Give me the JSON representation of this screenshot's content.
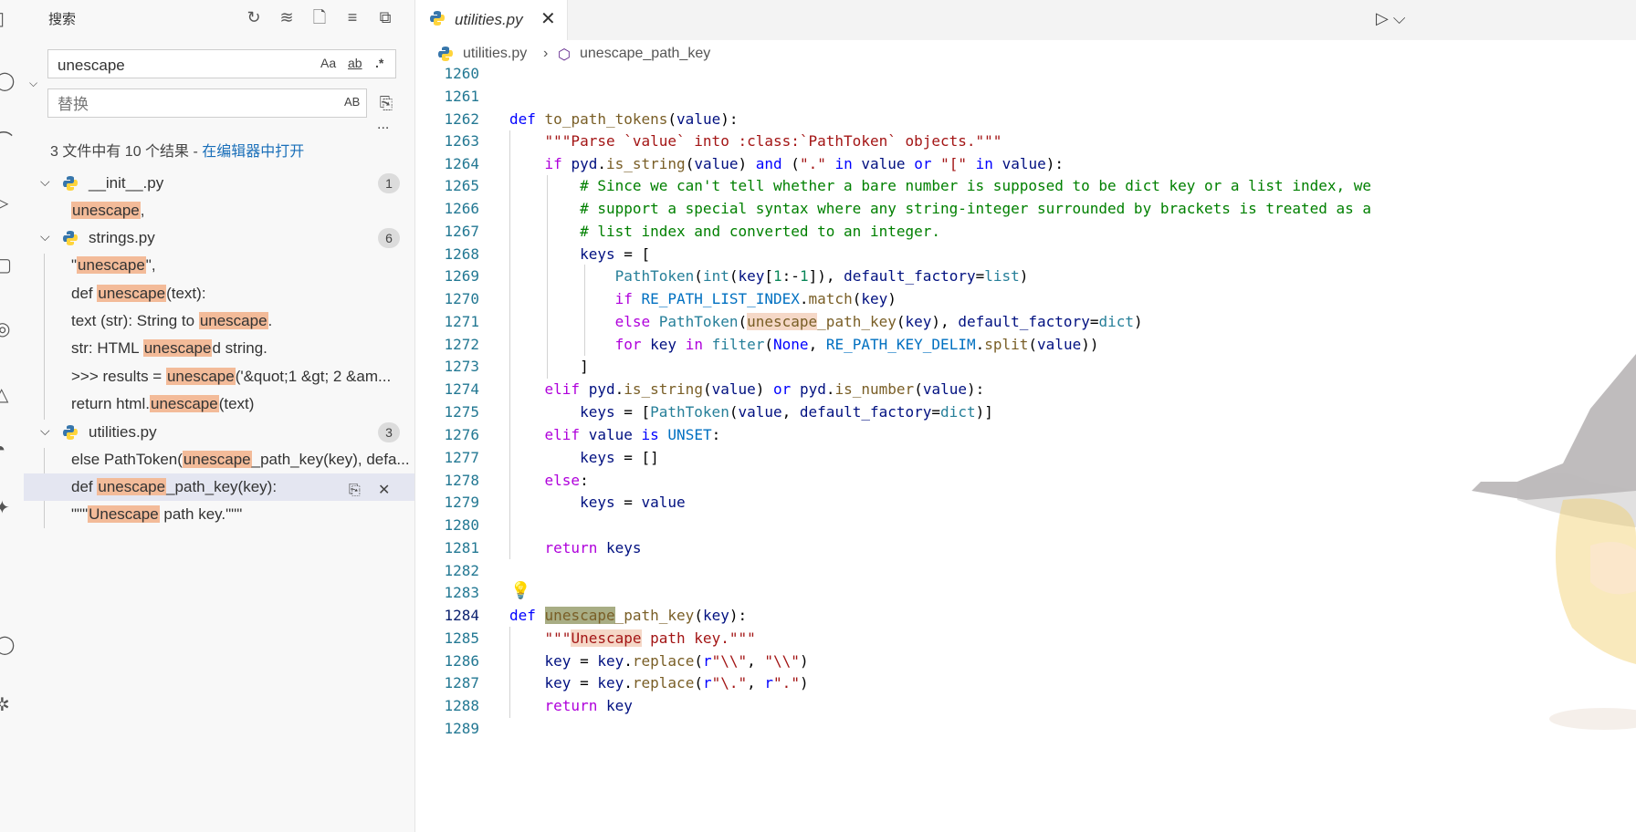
{
  "sidebar": {
    "title": "搜索",
    "search_value": "unescape",
    "replace_placeholder": "替换",
    "opt_case": "Aa",
    "opt_word": "ab",
    "opt_regex": ".*",
    "opt_preserve": "AB",
    "more": "...",
    "summary_text": "3 文件中有 10 个结果 - ",
    "summary_link": "在编辑器中打开",
    "files": [
      {
        "name": "__init__.py",
        "count": "1",
        "matches": [
          {
            "pre": "",
            "hit": "unescape",
            "post": ","
          }
        ]
      },
      {
        "name": "strings.py",
        "count": "6",
        "matches": [
          {
            "pre": "\"",
            "hit": "unescape",
            "post": "\","
          },
          {
            "pre": "def ",
            "hit": "unescape",
            "post": "(text):"
          },
          {
            "pre": "text (str): String to ",
            "hit": "unescape",
            "post": "."
          },
          {
            "pre": "str: HTML ",
            "hit": "unescape",
            "post": "d string."
          },
          {
            "pre": ">>> results = ",
            "hit": "unescape",
            "post": "('&quot;1 &gt; 2 &am..."
          },
          {
            "pre": "return html.",
            "hit": "unescape",
            "post": "(text)"
          }
        ]
      },
      {
        "name": "utilities.py",
        "count": "3",
        "matches": [
          {
            "pre": "else PathToken(",
            "hit": "unescape",
            "post": "_path_key(key), defa..."
          },
          {
            "pre": "def ",
            "hit": "unescape",
            "post": "_path_key(key):"
          },
          {
            "pre": "\"\"\"",
            "hit": "Unescape",
            "post": " path key.\"\"\""
          }
        ]
      }
    ]
  },
  "editor": {
    "tab_name": "utilities.py",
    "breadcrumb_file": "utilities.py",
    "breadcrumb_symbol": "unescape_path_key",
    "current_line": "1284",
    "line_numbers": [
      "1260",
      "1261",
      "1262",
      "1263",
      "1264",
      "1265",
      "1266",
      "1267",
      "1268",
      "1269",
      "1270",
      "1271",
      "1272",
      "1273",
      "1274",
      "1275",
      "1276",
      "1277",
      "1278",
      "1279",
      "1280",
      "1281",
      "1282",
      "1283",
      "1284",
      "1285",
      "1286",
      "1287",
      "1288",
      "1289"
    ]
  },
  "colors": {
    "match_highlight": "#f3bb99",
    "selected_row": "#e4e6f1",
    "link": "#1a6fb9"
  },
  "icons": [
    "refresh-icon",
    "clear-results-icon",
    "new-search-editor-icon",
    "collapse-all-icon",
    "view-as-tree-icon",
    "python-file-icon",
    "replace-icon",
    "dismiss-icon",
    "run-icon",
    "close-icon",
    "lightbulb-icon"
  ]
}
